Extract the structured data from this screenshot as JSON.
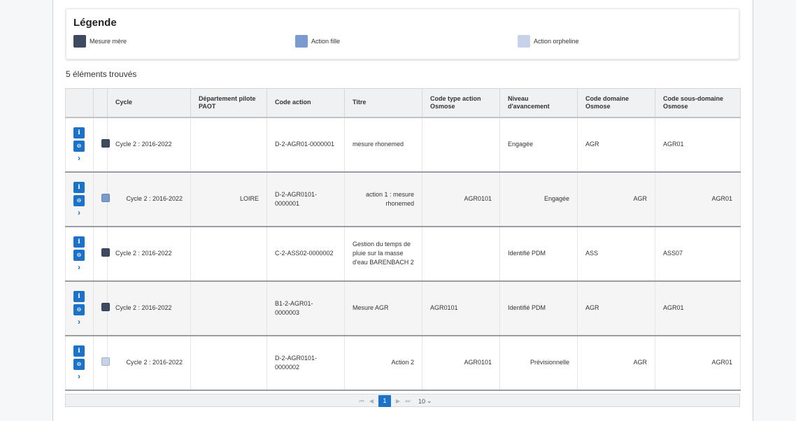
{
  "legend": {
    "title": "Légende",
    "items": [
      {
        "label": "Mesure mère",
        "color": "#3d4a5f"
      },
      {
        "label": "Action fille",
        "color": "#7a9bd0"
      },
      {
        "label": "Action orpheline",
        "color": "#c5d2e8"
      }
    ]
  },
  "results": {
    "count_text": "5 éléments trouvés"
  },
  "table": {
    "columns": [
      "",
      "",
      "Cycle",
      "Département pilote PAOT",
      "Code action",
      "Titre",
      "Code type action Osmose",
      "Niveau d'avancement",
      "Code domaine Osmose",
      "Code sous-domaine Osmose"
    ],
    "actions": {
      "info": "i",
      "print": "⊖",
      "expand": "›"
    },
    "rows": [
      {
        "type_color": "#3d4a5f",
        "cycle": "Cycle 2 : 2016-2022",
        "departement": "",
        "code_action": "D-2-AGR01-0000001",
        "titre": "mesure rhonemed",
        "code_type": "",
        "niveau": "Engagée",
        "domaine": "AGR",
        "sous_domaine": "AGR01"
      },
      {
        "type_color": "#7a9bd0",
        "cycle": "Cycle 2 : 2016-2022",
        "departement": "LOIRE",
        "code_action": "D-2-AGR0101-0000001",
        "titre": "action 1 : mesure rhonemed",
        "code_type": "AGR0101",
        "niveau": "Engagée",
        "domaine": "AGR",
        "sous_domaine": "AGR01"
      },
      {
        "type_color": "#3d4a5f",
        "cycle": "Cycle 2 : 2016-2022",
        "departement": "",
        "code_action": "C-2-ASS02-0000002",
        "titre": "Gestion du temps de pluie sur la masse d'eau BARENBACH 2",
        "code_type": "",
        "niveau": "Identifié PDM",
        "domaine": "ASS",
        "sous_domaine": "ASS07"
      },
      {
        "type_color": "#3d4a5f",
        "cycle": "Cycle 2 : 2016-2022",
        "departement": "",
        "code_action": "B1-2-AGR01-0000003",
        "titre": "Mesure AGR",
        "code_type": "AGR0101",
        "niveau": "Identifié PDM",
        "domaine": "AGR",
        "sous_domaine": "AGR01"
      },
      {
        "type_color": "#c5d2e8",
        "cycle": "Cycle 2 : 2016-2022",
        "departement": "",
        "code_action": "D-2-AGR0101-0000002",
        "titre": "Action 2",
        "code_type": "AGR0101",
        "niveau": "Prévisionnelle",
        "domaine": "AGR",
        "sous_domaine": "AGR01"
      }
    ]
  },
  "pager": {
    "first": "⏮",
    "prev": "◀",
    "current_page": "1",
    "next": "▶",
    "last": "⏭",
    "page_size": "10",
    "page_size_caret": "⌄"
  },
  "colors": {
    "accent": "#1a73c9",
    "header_bg": "#f0f1f2",
    "alt_row_bg": "#f5f5f5"
  }
}
